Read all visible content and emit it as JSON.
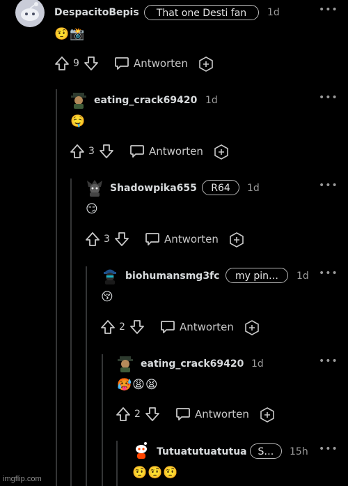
{
  "comments": [
    {
      "user": "DespacitoBepis",
      "flair": "That one Desti fan",
      "time": "1d",
      "body": "🤨📸",
      "votes": "9",
      "reply": "Antworten"
    },
    {
      "user": "eating_crack69420",
      "flair": "",
      "time": "1d",
      "body": "🤤",
      "votes": "3",
      "reply": "Antworten"
    },
    {
      "user": "Shadowpika655",
      "flair": "R64",
      "time": "1d",
      "body": "😏",
      "votes": "3",
      "reply": "Antworten"
    },
    {
      "user": "biohumansmg3fc",
      "flair": "my pin…",
      "time": "1d",
      "body": "😚",
      "votes": "2",
      "reply": "Antworten"
    },
    {
      "user": "eating_crack69420",
      "flair": "",
      "time": "1d",
      "body": "🥵😩😫",
      "votes": "2",
      "reply": "Antworten"
    },
    {
      "user": "Tutuatutuatutua",
      "flair": "S…",
      "time": "15h",
      "body": "🤨🤨🤨",
      "votes": "",
      "reply": ""
    }
  ],
  "menu_icon": "more-dots-icon",
  "watermark": "imgflip.com"
}
